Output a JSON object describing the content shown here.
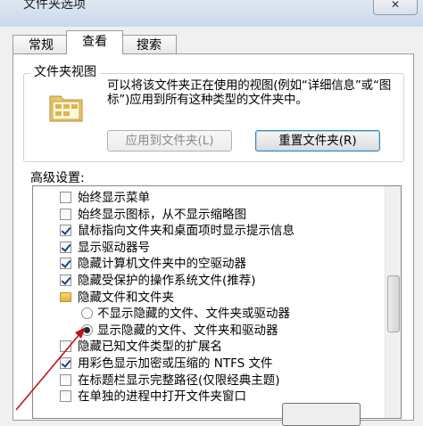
{
  "window": {
    "title": "文件夹选项",
    "close_label": "✕"
  },
  "tabs": [
    {
      "label": "常规"
    },
    {
      "label": "查看",
      "active": true
    },
    {
      "label": "搜索"
    }
  ],
  "folder_views": {
    "group_label": "文件夹视图",
    "description": "可以将该文件夹正在使用的视图(例如“详细信息”或“图标”)应用到所有这种类型的文件夹中。",
    "apply_button": "应用到文件夹(L)",
    "reset_button": "重置文件夹(R)"
  },
  "advanced": {
    "label": "高级设置:",
    "items": [
      {
        "type": "checkbox",
        "checked": false,
        "label": "始终显示菜单"
      },
      {
        "type": "checkbox",
        "checked": false,
        "label": "始终显示图标，从不显示缩略图"
      },
      {
        "type": "checkbox",
        "checked": true,
        "label": "鼠标指向文件夹和桌面项时显示提示信息"
      },
      {
        "type": "checkbox",
        "checked": true,
        "label": "显示驱动器号"
      },
      {
        "type": "checkbox",
        "checked": true,
        "label": "隐藏计算机文件夹中的空驱动器"
      },
      {
        "type": "checkbox",
        "checked": true,
        "label": "隐藏受保护的操作系统文件(推荐)"
      },
      {
        "type": "folder",
        "label": "隐藏文件和文件夹"
      },
      {
        "type": "radio",
        "checked": false,
        "label": "不显示隐藏的文件、文件夹或驱动器"
      },
      {
        "type": "radio",
        "checked": true,
        "label": "显示隐藏的文件、文件夹和驱动器"
      },
      {
        "type": "checkbox",
        "checked": false,
        "label": "隐藏已知文件类型的扩展名"
      },
      {
        "type": "checkbox",
        "checked": true,
        "label": "用彩色显示加密或压缩的 NTFS 文件"
      },
      {
        "type": "checkbox",
        "checked": false,
        "label": "在标题栏显示完整路径(仅限经典主题)"
      },
      {
        "type": "checkbox",
        "checked": false,
        "label": "在单独的进程中打开文件夹窗口"
      }
    ]
  },
  "colors": {
    "accent": "#3c7fb1",
    "annotation_arrow": "#c0141b"
  }
}
